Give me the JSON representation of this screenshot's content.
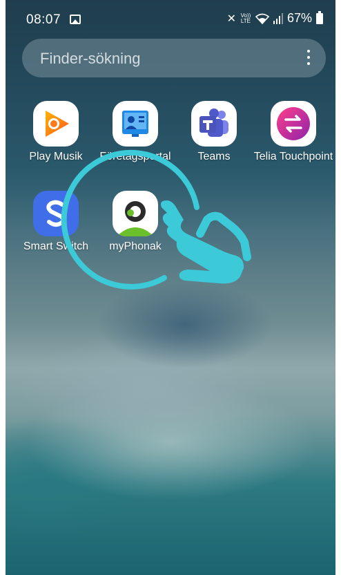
{
  "status_bar": {
    "time": "08:07",
    "volte": "Vo)) LTE",
    "battery": "67%",
    "icons": [
      "gallery-icon",
      "mute-icon",
      "volte-icon",
      "wifi-icon",
      "signal-icon",
      "battery-icon"
    ]
  },
  "search": {
    "placeholder": "Finder-sökning",
    "more_icon": "more-vert-icon"
  },
  "apps": [
    {
      "label": "Play Musik",
      "icon": "play-music-icon"
    },
    {
      "label": "Företagsportal",
      "icon": "company-portal-icon"
    },
    {
      "label": "Teams",
      "icon": "teams-icon"
    },
    {
      "label": "Telia Touchpoint",
      "icon": "telia-touchpoint-icon"
    },
    {
      "label": "Smart Switch",
      "icon": "smart-switch-icon"
    },
    {
      "label": "myPhonak",
      "icon": "myphonak-icon"
    }
  ],
  "overlay": {
    "icon": "tap-hand-icon",
    "color": "#3cc9d8"
  }
}
